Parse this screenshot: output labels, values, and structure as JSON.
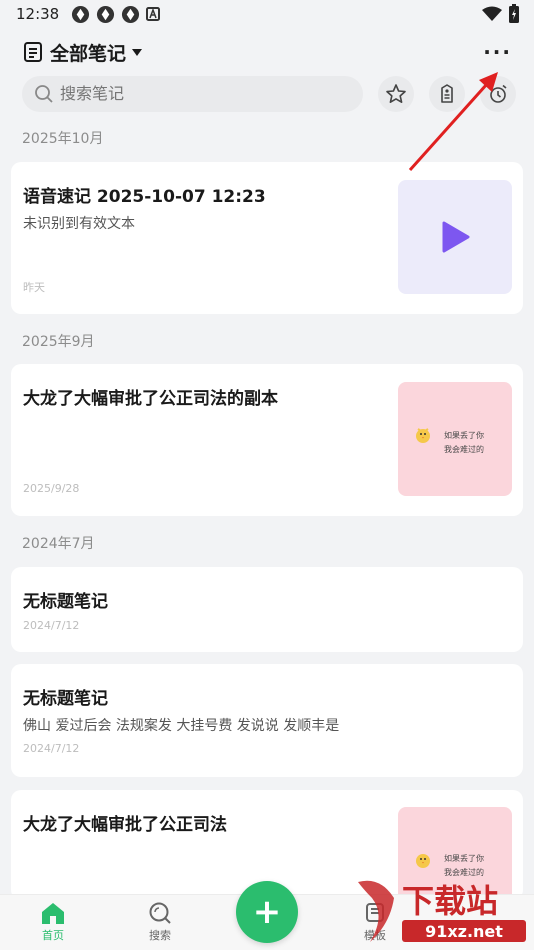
{
  "status_bar": {
    "time": "12:38"
  },
  "header": {
    "title": "全部笔记",
    "more_label": "···"
  },
  "search": {
    "placeholder": "搜索笔记"
  },
  "sections": [
    {
      "label": "2025年10月"
    },
    {
      "label": "2025年9月"
    },
    {
      "label": "2024年7月"
    }
  ],
  "notes": [
    {
      "title": "语音速记 2025-10-07 12:23",
      "subtitle": "未识别到有效文本",
      "date": "昨天",
      "thumbnail": "voice-play"
    },
    {
      "title": "大龙了大幅审批了公正司法的副本",
      "subtitle": "",
      "date": "2025/9/28",
      "thumbnail": "pink-sticker",
      "thumb_line1": "如果丢了你",
      "thumb_line2": "我会难过的"
    },
    {
      "title": "无标题笔记",
      "subtitle": "",
      "date": "2024/7/12",
      "thumbnail": ""
    },
    {
      "title": "无标题笔记",
      "subtitle": "佛山 爱过后会 法规案发 大挂号费 发说说 发顺丰是",
      "date": "2024/7/12",
      "thumbnail": ""
    },
    {
      "title": "大龙了大幅审批了公正司法",
      "subtitle": "",
      "date": "",
      "thumbnail": "pink-sticker",
      "thumb_line1": "如果丢了你",
      "thumb_line2": "我会难过的"
    }
  ],
  "bottom_nav": {
    "home_label": "首页",
    "search_label": "搜索",
    "add_label": "+",
    "template_label": "模板"
  },
  "watermark": {
    "text_big": "下载站",
    "text_small": "91xz.net"
  },
  "colors": {
    "accent": "#2bbd6e",
    "play": "#7d57f0",
    "arrow": "#e02020",
    "thumb_pink": "#fbd6dc",
    "thumb_voice": "#ecebfa"
  }
}
